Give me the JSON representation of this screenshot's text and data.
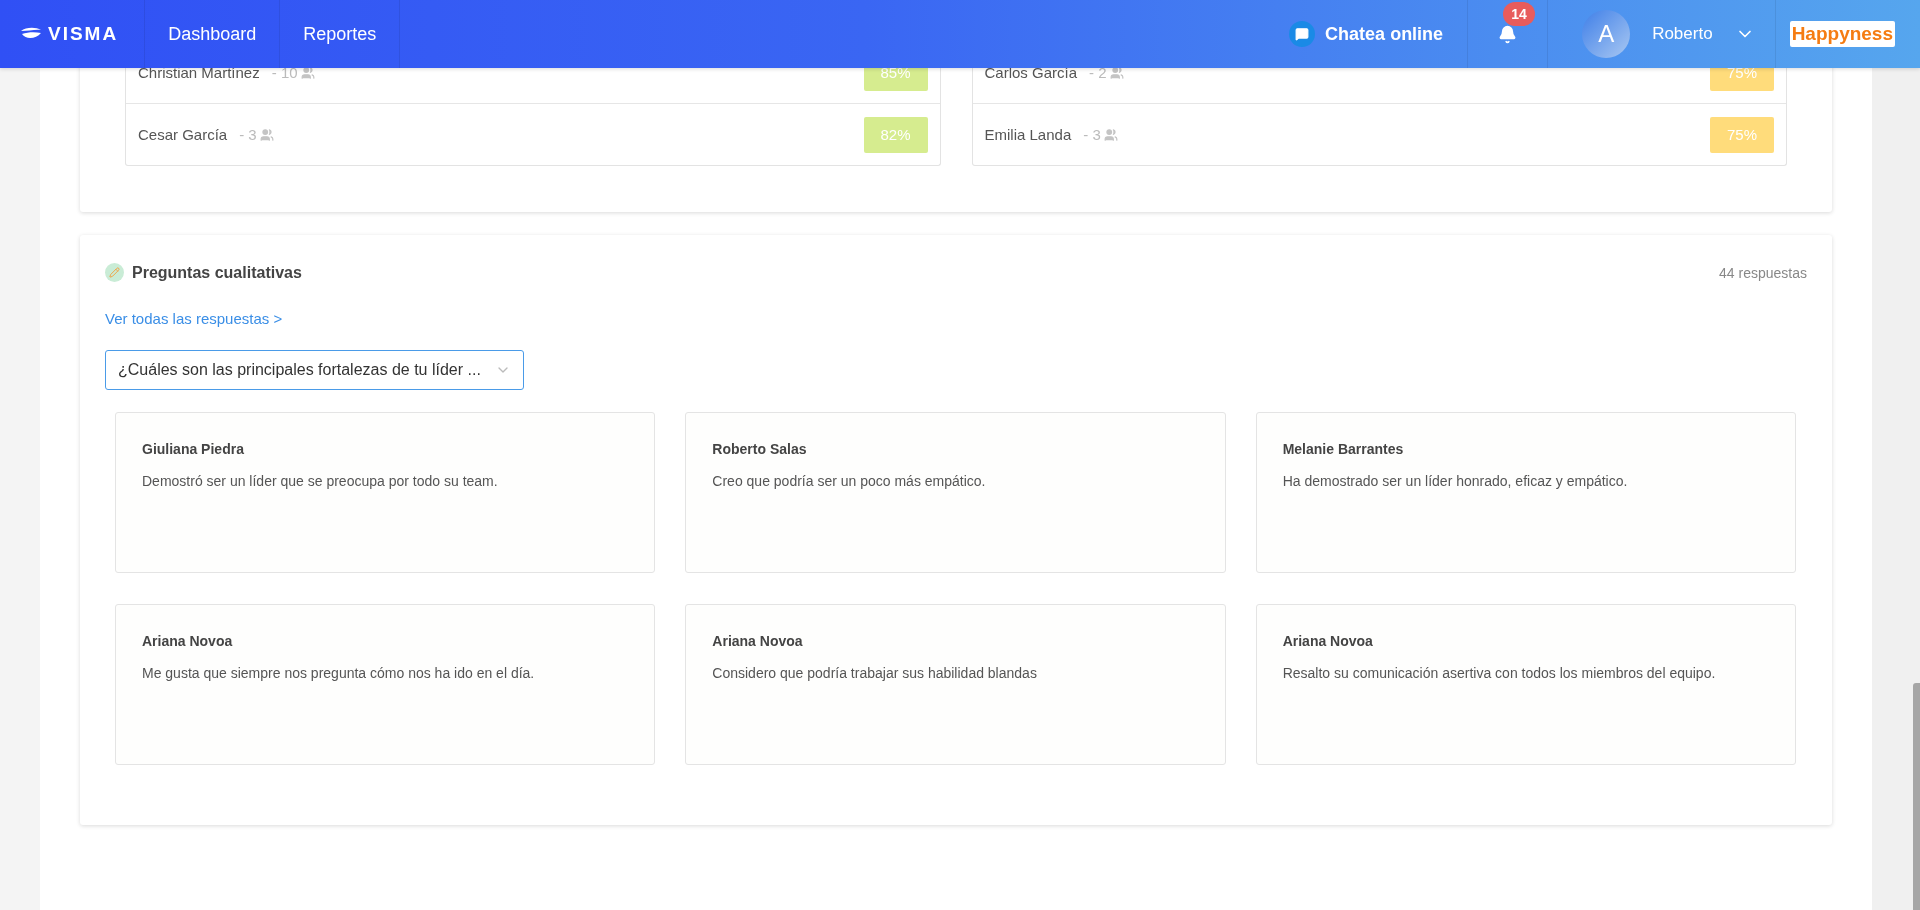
{
  "header": {
    "logo": "VISMA",
    "nav": [
      "Dashboard",
      "Reportes"
    ],
    "chat": "Chatea online",
    "notifications": "14",
    "user": {
      "initial": "A",
      "name": "Roberto"
    },
    "brand": "Happyness"
  },
  "ranking": {
    "lists": [
      {
        "rows": [
          {
            "name": "Christian Martínez",
            "count": "- 10",
            "score": "85%",
            "color": "#d6ec8f"
          },
          {
            "name": "Cesar García",
            "count": "- 3",
            "score": "82%",
            "color": "#d6ec8f"
          }
        ]
      },
      {
        "rows": [
          {
            "name": "Carlos García",
            "count": "- 2",
            "score": "75%",
            "color": "#ffdc7b"
          },
          {
            "name": "Emilia Landa",
            "count": "- 3",
            "score": "75%",
            "color": "#ffdc7b"
          }
        ]
      }
    ]
  },
  "qualitative": {
    "title": "Preguntas cualitativas",
    "count": "44 respuestas",
    "link": "Ver todas las respuestas >",
    "question": "¿Cuáles son las principales fortalezas de tu líder ...",
    "answers": [
      {
        "author": "Giuliana Piedra",
        "text": "Demostró ser un líder que se preocupa por todo su team."
      },
      {
        "author": "Roberto Salas",
        "text": "Creo que podría ser un poco más empático."
      },
      {
        "author": "Melanie Barrantes",
        "text": "Ha demostrado ser un líder honrado, eficaz y empático."
      },
      {
        "author": "Ariana Novoa",
        "text": "Me gusta que siempre nos pregunta cómo nos ha ido en el día."
      },
      {
        "author": "Ariana Novoa",
        "text": "Considero que podría trabajar sus habilidad blandas"
      },
      {
        "author": "Ariana Novoa",
        "text": "Resalto su comunicación asertiva con todos los miembros del equipo."
      }
    ]
  }
}
